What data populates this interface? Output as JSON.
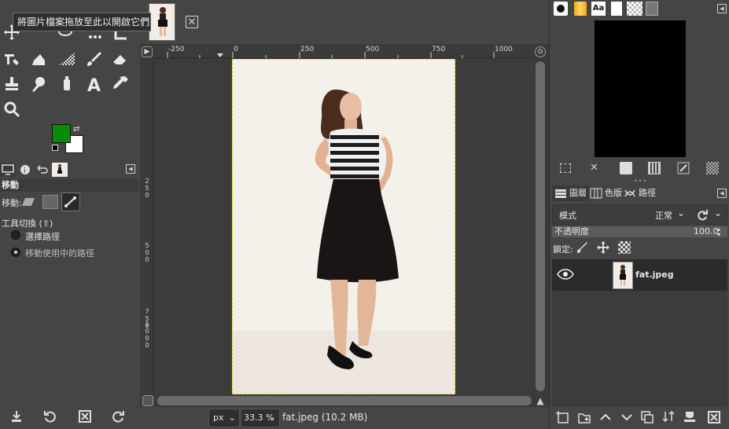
{
  "tooltip": "將圖片檔案拖放至此以開啟它們",
  "toolbox": {
    "fg_color": "#0c8a0c",
    "bg_color": "#ffffff",
    "tools": [
      "move-tool-icon",
      "rect-select-icon",
      "lasso-icon",
      "fuzzy-select-icon",
      "crop-icon",
      "transform-icon",
      "bucket-fill-icon",
      "gradient-icon",
      "paintbrush-icon",
      "eraser-icon",
      "clone-icon",
      "smudge-icon",
      "dodge-icon",
      "text-tool-icon",
      "color-picker-icon",
      "zoom-tool-icon"
    ]
  },
  "tool_options": {
    "title": "移動",
    "move_label": "移動:",
    "toggle_label": "工具切換 (⇧)",
    "radio_pick": "選擇路徑",
    "radio_move": "移動使用中的路徑"
  },
  "ruler": {
    "top_labels": [
      "-250",
      "0",
      "250",
      "500",
      "750",
      "1000"
    ],
    "left_labels": [
      "2",
      "5",
      "0",
      "5",
      "0",
      "0",
      "7",
      "5",
      "0",
      "1",
      "0",
      "0",
      "0"
    ]
  },
  "statusbar": {
    "unit": "px",
    "zoom": "33.3 %",
    "file_info": "fat.jpeg (10.2 MB)"
  },
  "layers_panel": {
    "tabs": [
      "圖層",
      "色版",
      "路徑"
    ],
    "mode_label": "模式",
    "mode_value": "正常",
    "opacity_label": "不透明度",
    "opacity_value": "100.0",
    "lock_label": "鎖定:",
    "layer_name": "fat.jpeg"
  },
  "colors": {
    "accent_fg": "#0c8a0c",
    "selection_border": "#d6d600"
  }
}
